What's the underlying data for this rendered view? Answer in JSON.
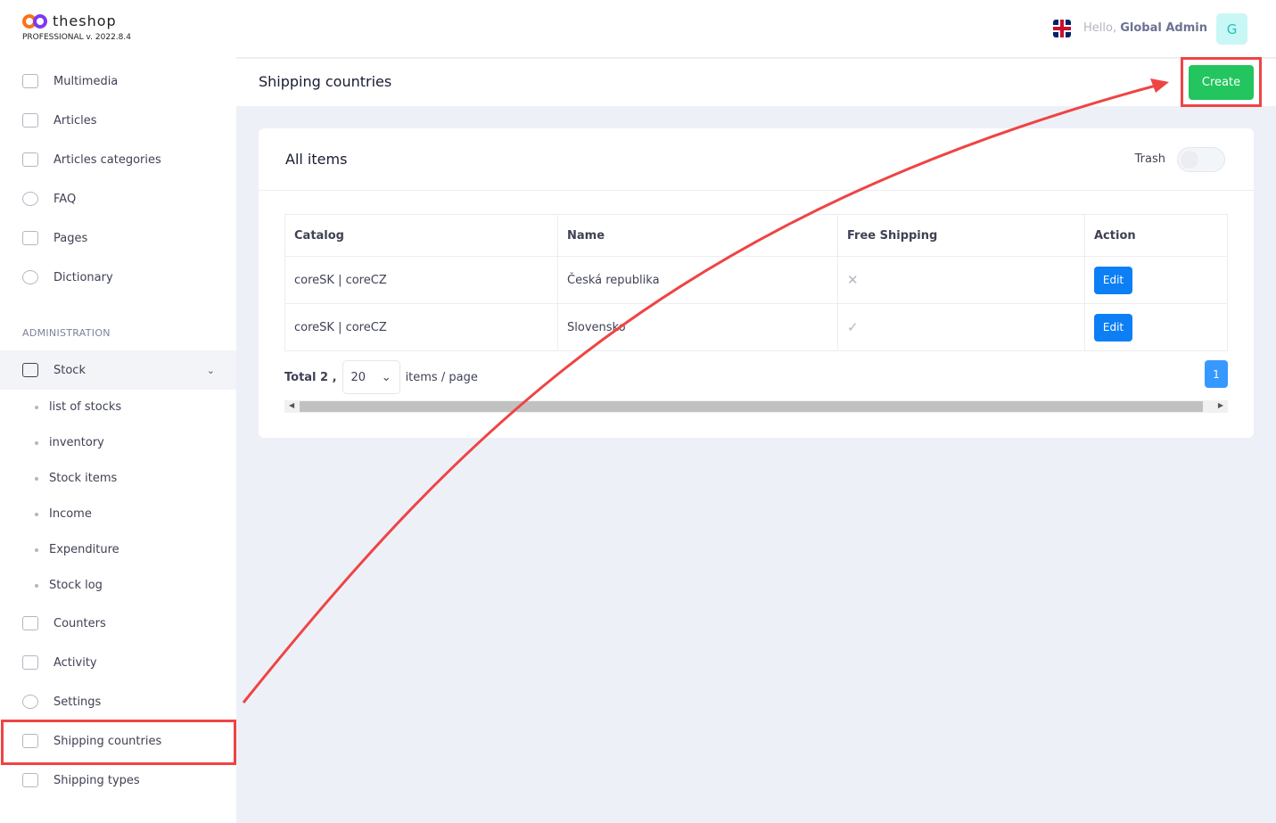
{
  "brand": {
    "name": "theshop",
    "version": "PROFESSIONAL v. 2022.8.4"
  },
  "sidebar": {
    "items": [
      {
        "label": "Multimedia",
        "icon": "image-icon"
      },
      {
        "label": "Articles",
        "icon": "edit-icon"
      },
      {
        "label": "Articles categories",
        "icon": "copy-icon"
      },
      {
        "label": "FAQ",
        "icon": "lifebuoy-icon"
      },
      {
        "label": "Pages",
        "icon": "browser-icon"
      },
      {
        "label": "Dictionary",
        "icon": "globe-icon"
      }
    ],
    "section": "ADMINISTRATION",
    "stock": {
      "label": "Stock",
      "icon": "box-icon"
    },
    "stock_sub": [
      "list of stocks",
      "inventory",
      "Stock items",
      "Income",
      "Expenditure",
      "Stock log"
    ],
    "items2": [
      {
        "label": "Counters",
        "icon": "list-icon"
      },
      {
        "label": "Activity",
        "icon": "calendar-icon"
      },
      {
        "label": "Settings",
        "icon": "gear-icon"
      },
      {
        "label": "Shipping countries",
        "icon": "map-pin-icon"
      },
      {
        "label": "Shipping types",
        "icon": "truck-icon"
      }
    ]
  },
  "header": {
    "hello": "Hello,",
    "user": "Global Admin",
    "avatar": "G",
    "language": "en-GB"
  },
  "page": {
    "title": "Shipping countries",
    "create": "Create"
  },
  "card": {
    "title": "All items",
    "trash": "Trash",
    "trash_on": false
  },
  "table": {
    "columns": [
      "Catalog",
      "Name",
      "Free Shipping",
      "Action"
    ],
    "rows": [
      {
        "catalog": "coreSK | coreCZ",
        "name": "Česká republika",
        "free": "✕",
        "action": "Edit"
      },
      {
        "catalog": "coreSK | coreCZ",
        "name": "Slovensko",
        "free": "✓",
        "action": "Edit"
      }
    ]
  },
  "pagination": {
    "total": "Total 2 ,",
    "per_page": "20",
    "suffix": "items / page",
    "page": "1"
  },
  "colors": {
    "create": "#22c55e",
    "edit": "#0d7ff5",
    "highlight": "#ef4444"
  }
}
